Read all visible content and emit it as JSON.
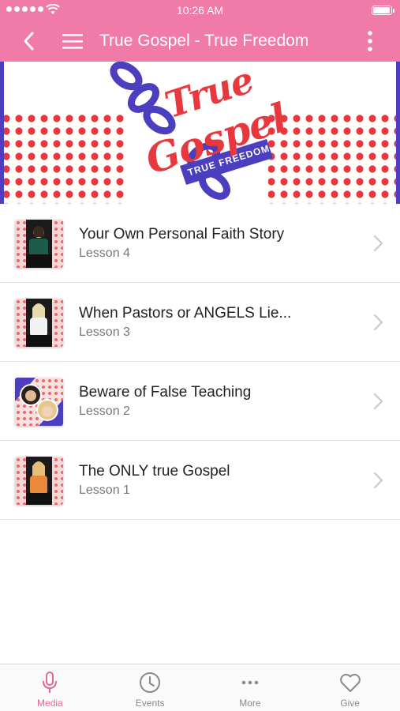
{
  "status_bar": {
    "time": "10:26 AM"
  },
  "nav": {
    "title": "True Gospel - True Freedom"
  },
  "banner": {
    "line1": "True",
    "line2": "Gospel",
    "tagline": "TRUE FREEDOM"
  },
  "lessons": [
    {
      "title": "Your Own Personal Faith Story",
      "subtitle": "Lesson 4"
    },
    {
      "title": "When Pastors or ANGELS Lie...",
      "subtitle": "Lesson 3"
    },
    {
      "title": "Beware of False Teaching",
      "subtitle": "Lesson 2"
    },
    {
      "title": "The ONLY true Gospel",
      "subtitle": "Lesson 1"
    }
  ],
  "tabs": [
    {
      "label": "Media",
      "icon": "microphone-icon",
      "active": true
    },
    {
      "label": "Events",
      "icon": "clock-icon",
      "active": false
    },
    {
      "label": "More",
      "icon": "more-dots-icon",
      "active": false
    },
    {
      "label": "Give",
      "icon": "heart-icon",
      "active": false
    }
  ],
  "colors": {
    "brand_pink": "#f07aa8",
    "active_tab": "#e6669a",
    "banner_red": "#e8383d",
    "banner_blue": "#4b3fbf"
  }
}
